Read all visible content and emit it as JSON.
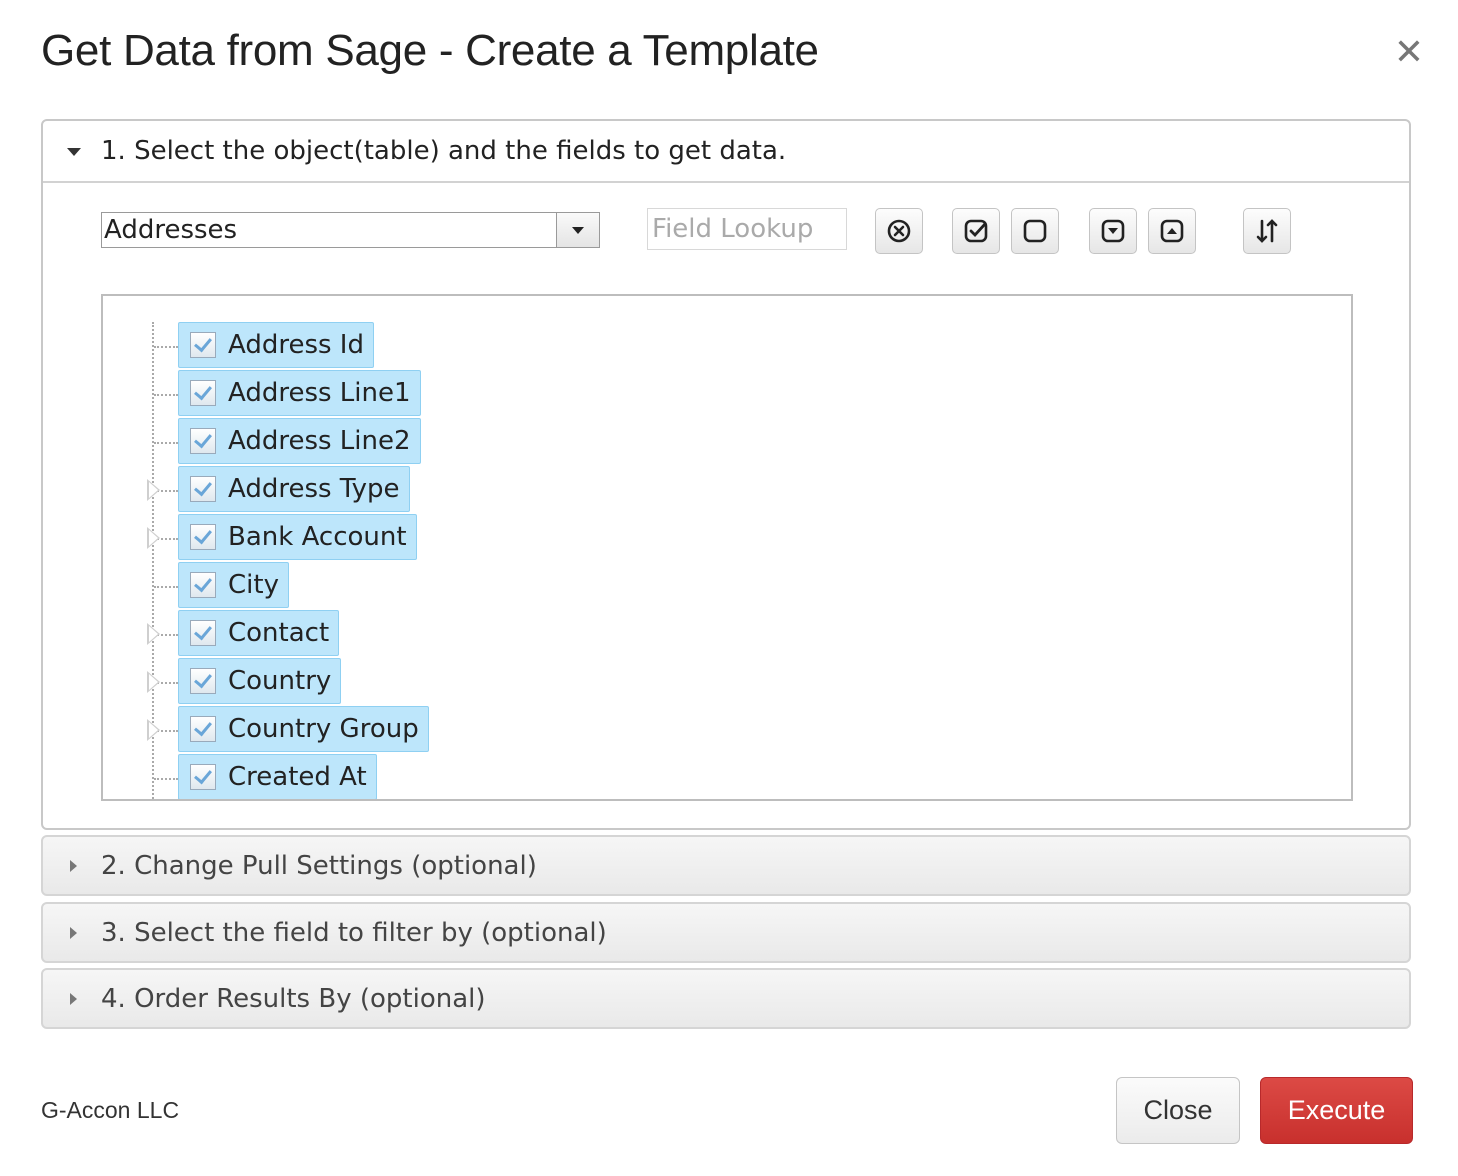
{
  "dialog": {
    "title": "Get Data from Sage - Create a Template",
    "close_glyph": "✕"
  },
  "section1": {
    "header": "1. Select the object(table) and the fields to get data.",
    "object_select": {
      "value": "Addresses"
    },
    "field_lookup": {
      "placeholder": "Field Lookup",
      "value": ""
    },
    "toolbar_icons": [
      "clear-icon",
      "check-all-icon",
      "uncheck-all-icon",
      "expand-icon",
      "collapse-icon",
      "sort-icon"
    ],
    "fields": [
      {
        "label": "Address Id",
        "checked": true,
        "expandable": false
      },
      {
        "label": "Address Line1",
        "checked": true,
        "expandable": false
      },
      {
        "label": "Address Line2",
        "checked": true,
        "expandable": false
      },
      {
        "label": "Address Type",
        "checked": true,
        "expandable": true
      },
      {
        "label": "Bank Account",
        "checked": true,
        "expandable": true
      },
      {
        "label": "City",
        "checked": true,
        "expandable": false
      },
      {
        "label": "Contact",
        "checked": true,
        "expandable": true
      },
      {
        "label": "Country",
        "checked": true,
        "expandable": true
      },
      {
        "label": "Country Group",
        "checked": true,
        "expandable": true
      },
      {
        "label": "Created At",
        "checked": true,
        "expandable": false
      }
    ]
  },
  "section2": {
    "header": "2. Change Pull Settings (optional)"
  },
  "section3": {
    "header": "3. Select the field to filter by (optional)"
  },
  "section4": {
    "header": "4. Order Results By (optional)"
  },
  "footer": {
    "company": "G-Accon LLC",
    "close_label": "Close",
    "execute_label": "Execute"
  },
  "colors": {
    "execute": "#d03a36",
    "chip_bg": "#bde6fb"
  }
}
